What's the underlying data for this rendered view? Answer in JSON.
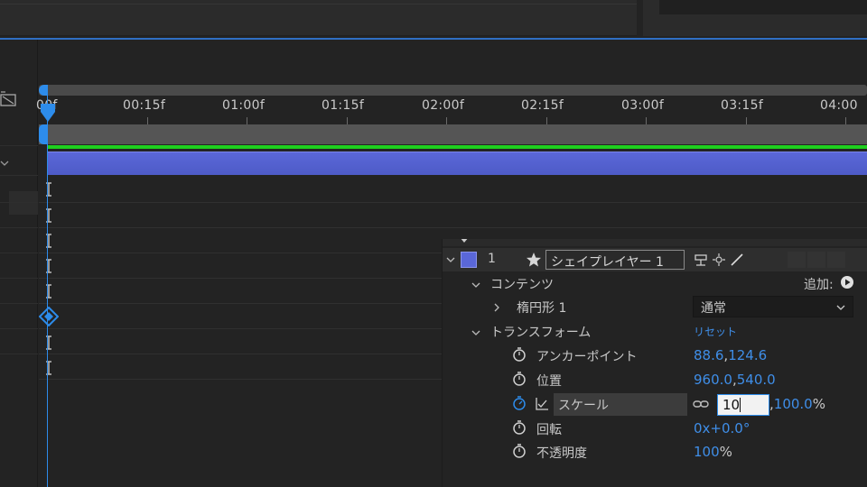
{
  "ruler": {
    "labels": [
      "00f",
      "00:15f",
      "01:00f",
      "01:15f",
      "02:00f",
      "02:15f",
      "03:00f",
      "03:15f",
      "04:00"
    ]
  },
  "layer": {
    "number": "1",
    "name": "シェイプレイヤー 1",
    "color": "#5a67d8"
  },
  "contents": {
    "label": "コンテンツ",
    "add_label": "追加:",
    "ellipse_label": "楕円形 1",
    "blend_mode": "通常"
  },
  "transform": {
    "label": "トランスフォーム",
    "reset_label": "リセット",
    "anchor_label": "アンカーポイント",
    "anchor_x": "88.6",
    "anchor_y": "124.6",
    "position_label": "位置",
    "position_x": "960.0",
    "position_y": "540.0",
    "scale_label": "スケール",
    "scale_input_value": "10",
    "scale_y": "100.0",
    "scale_unit": "%",
    "rotation_label": "回転",
    "rotation_value": "0x+0.0°",
    "opacity_label": "不透明度",
    "opacity_value": "100",
    "opacity_unit": "%"
  },
  "colors": {
    "accent": "#2d8ceb",
    "value_blue": "#3f8ee8",
    "layer_bar": "#5a67d8",
    "range_green": "#1ecf1e"
  }
}
